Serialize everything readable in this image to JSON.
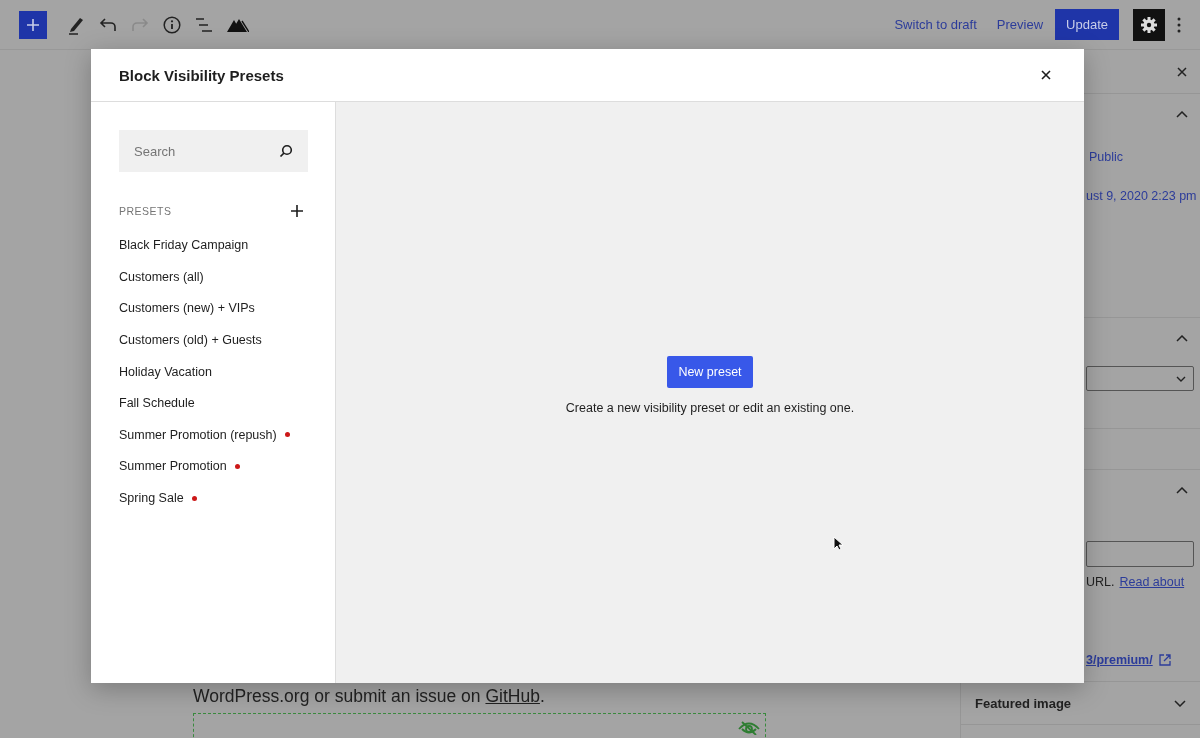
{
  "toolbar": {
    "undo": {
      "disabled": false
    },
    "redo": {
      "disabled": true
    },
    "actions": [
      "Switch to draft",
      "Preview"
    ],
    "primary": "Update",
    "settings": {
      "pressed": true
    }
  },
  "editor": {
    "text": "WordPress.org or submit an issue on ",
    "link": "GitHub",
    "end": "."
  },
  "sidebar": {
    "visibility": "Public",
    "publish_date": "ust 9, 2020 2:23 pm",
    "permalink_note": "URL.",
    "permalink_link": "Read about",
    "permalink_url": "3/premium/",
    "featured_image": "Featured image"
  },
  "modal": {
    "title": "Block Visibility Presets",
    "search": {
      "placeholder": "Search"
    },
    "section_label": "PRESETS",
    "presets": [
      {
        "name": "Black Friday Campaign",
        "flagged": false
      },
      {
        "name": "Customers (all)",
        "flagged": false
      },
      {
        "name": "Customers (new) + VIPs",
        "flagged": false
      },
      {
        "name": "Customers (old) + Guests",
        "flagged": false
      },
      {
        "name": "Holiday Vacation",
        "flagged": false
      },
      {
        "name": "Fall Schedule",
        "flagged": false
      },
      {
        "name": "Summer Promotion (repush)",
        "flagged": true
      },
      {
        "name": "Summer Promotion",
        "flagged": true
      },
      {
        "name": "Spring Sale",
        "flagged": true
      }
    ],
    "button": "New preset",
    "hint": "Create a new visibility preset or edit an existing one."
  }
}
